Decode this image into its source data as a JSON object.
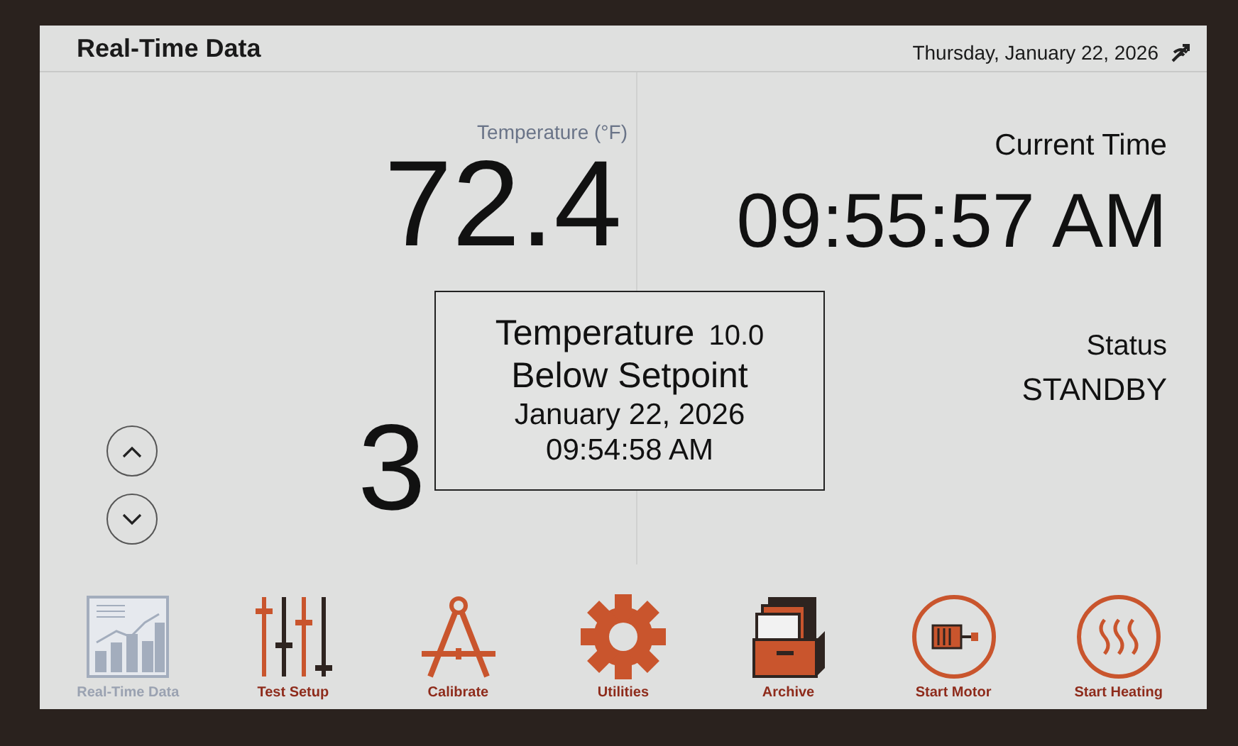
{
  "header": {
    "title": "Real-Time Data",
    "date": "Thursday, January 22, 2026"
  },
  "temperature": {
    "label": "Temperature (°F)",
    "value": "72.4",
    "second_value": "3"
  },
  "current_time": {
    "label": "Current Time",
    "value": "09:55:57 AM"
  },
  "status": {
    "label": "Status",
    "value": "STANDBY"
  },
  "alarm": {
    "title": "Temperature",
    "value": "10.0",
    "message": "Below Setpoint",
    "date": "January 22, 2026",
    "time": "09:54:58 AM"
  },
  "toolbar": [
    {
      "kind": "chart",
      "label": "Real-Time Data",
      "selected": true
    },
    {
      "kind": "sliders",
      "label": "Test Setup",
      "selected": false
    },
    {
      "kind": "compass",
      "label": "Calibrate",
      "selected": false
    },
    {
      "kind": "gear",
      "label": "Utilities",
      "selected": false
    },
    {
      "kind": "archive",
      "label": "Archive",
      "selected": false
    },
    {
      "kind": "motor",
      "label": "Start Motor",
      "selected": false
    },
    {
      "kind": "heating",
      "label": "Start Heating",
      "selected": false
    }
  ]
}
